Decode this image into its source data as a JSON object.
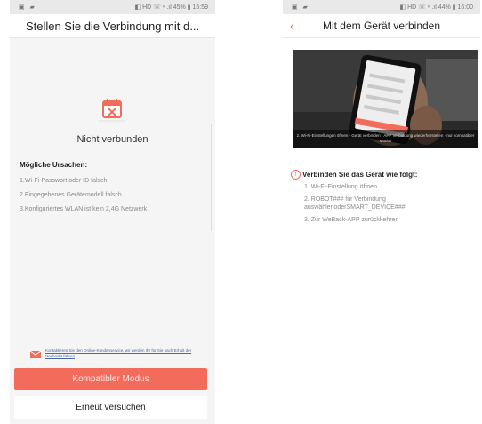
{
  "left": {
    "status": {
      "left": "▣ ▰",
      "right": "◧ HD ☏ ⁿ .ıl 45% ▮ 15:59"
    },
    "title": "Stellen Sie die Verbindung mit d...",
    "icon": "calendar-x-icon",
    "status_text": "Nicht verbunden",
    "causes_heading": "Mögliche Ursachen:",
    "causes": [
      "1.Wi-Fi-Passwort oder ID falsch;",
      "2.Eingegebenes Gerätemodell falsch",
      "3.Konfiguriertes WLAN ist kein 2,4G Netzwerk"
    ],
    "contact_text": "Kontaktieren Sie den Online-Kundenservice, wir werden Ihr für Sie nach Erhalt der Nachricht führen",
    "primary_button": "Kompatibler Modus",
    "secondary_button": "Erneut versuchen"
  },
  "right": {
    "status": {
      "left": "▣ ▰",
      "right": "◧ HD ☏ ⁿ .ıl 44% ▮ 16:00"
    },
    "title": "Mit dem Gerät verbinden",
    "back_icon": "chevron-left-icon",
    "video_caption": "2. Wi-Fi-Einstellungen öffnen · Gerät verbinden · APP Verbindung wiederherstellen · nur kompatibler Modus",
    "instructions_heading": "Verbinden Sie das Gerät wie folgt:",
    "steps": [
      "1. Wi-Fi-Einstellung öffnen",
      "2. ROBOT### für Verbindung auswählenoderSMART_DEVICE###",
      "3. Zur WeBack-APP zurückkehren"
    ]
  },
  "colors": {
    "accent": "#f26b5b",
    "background": "#f5f5f5"
  }
}
